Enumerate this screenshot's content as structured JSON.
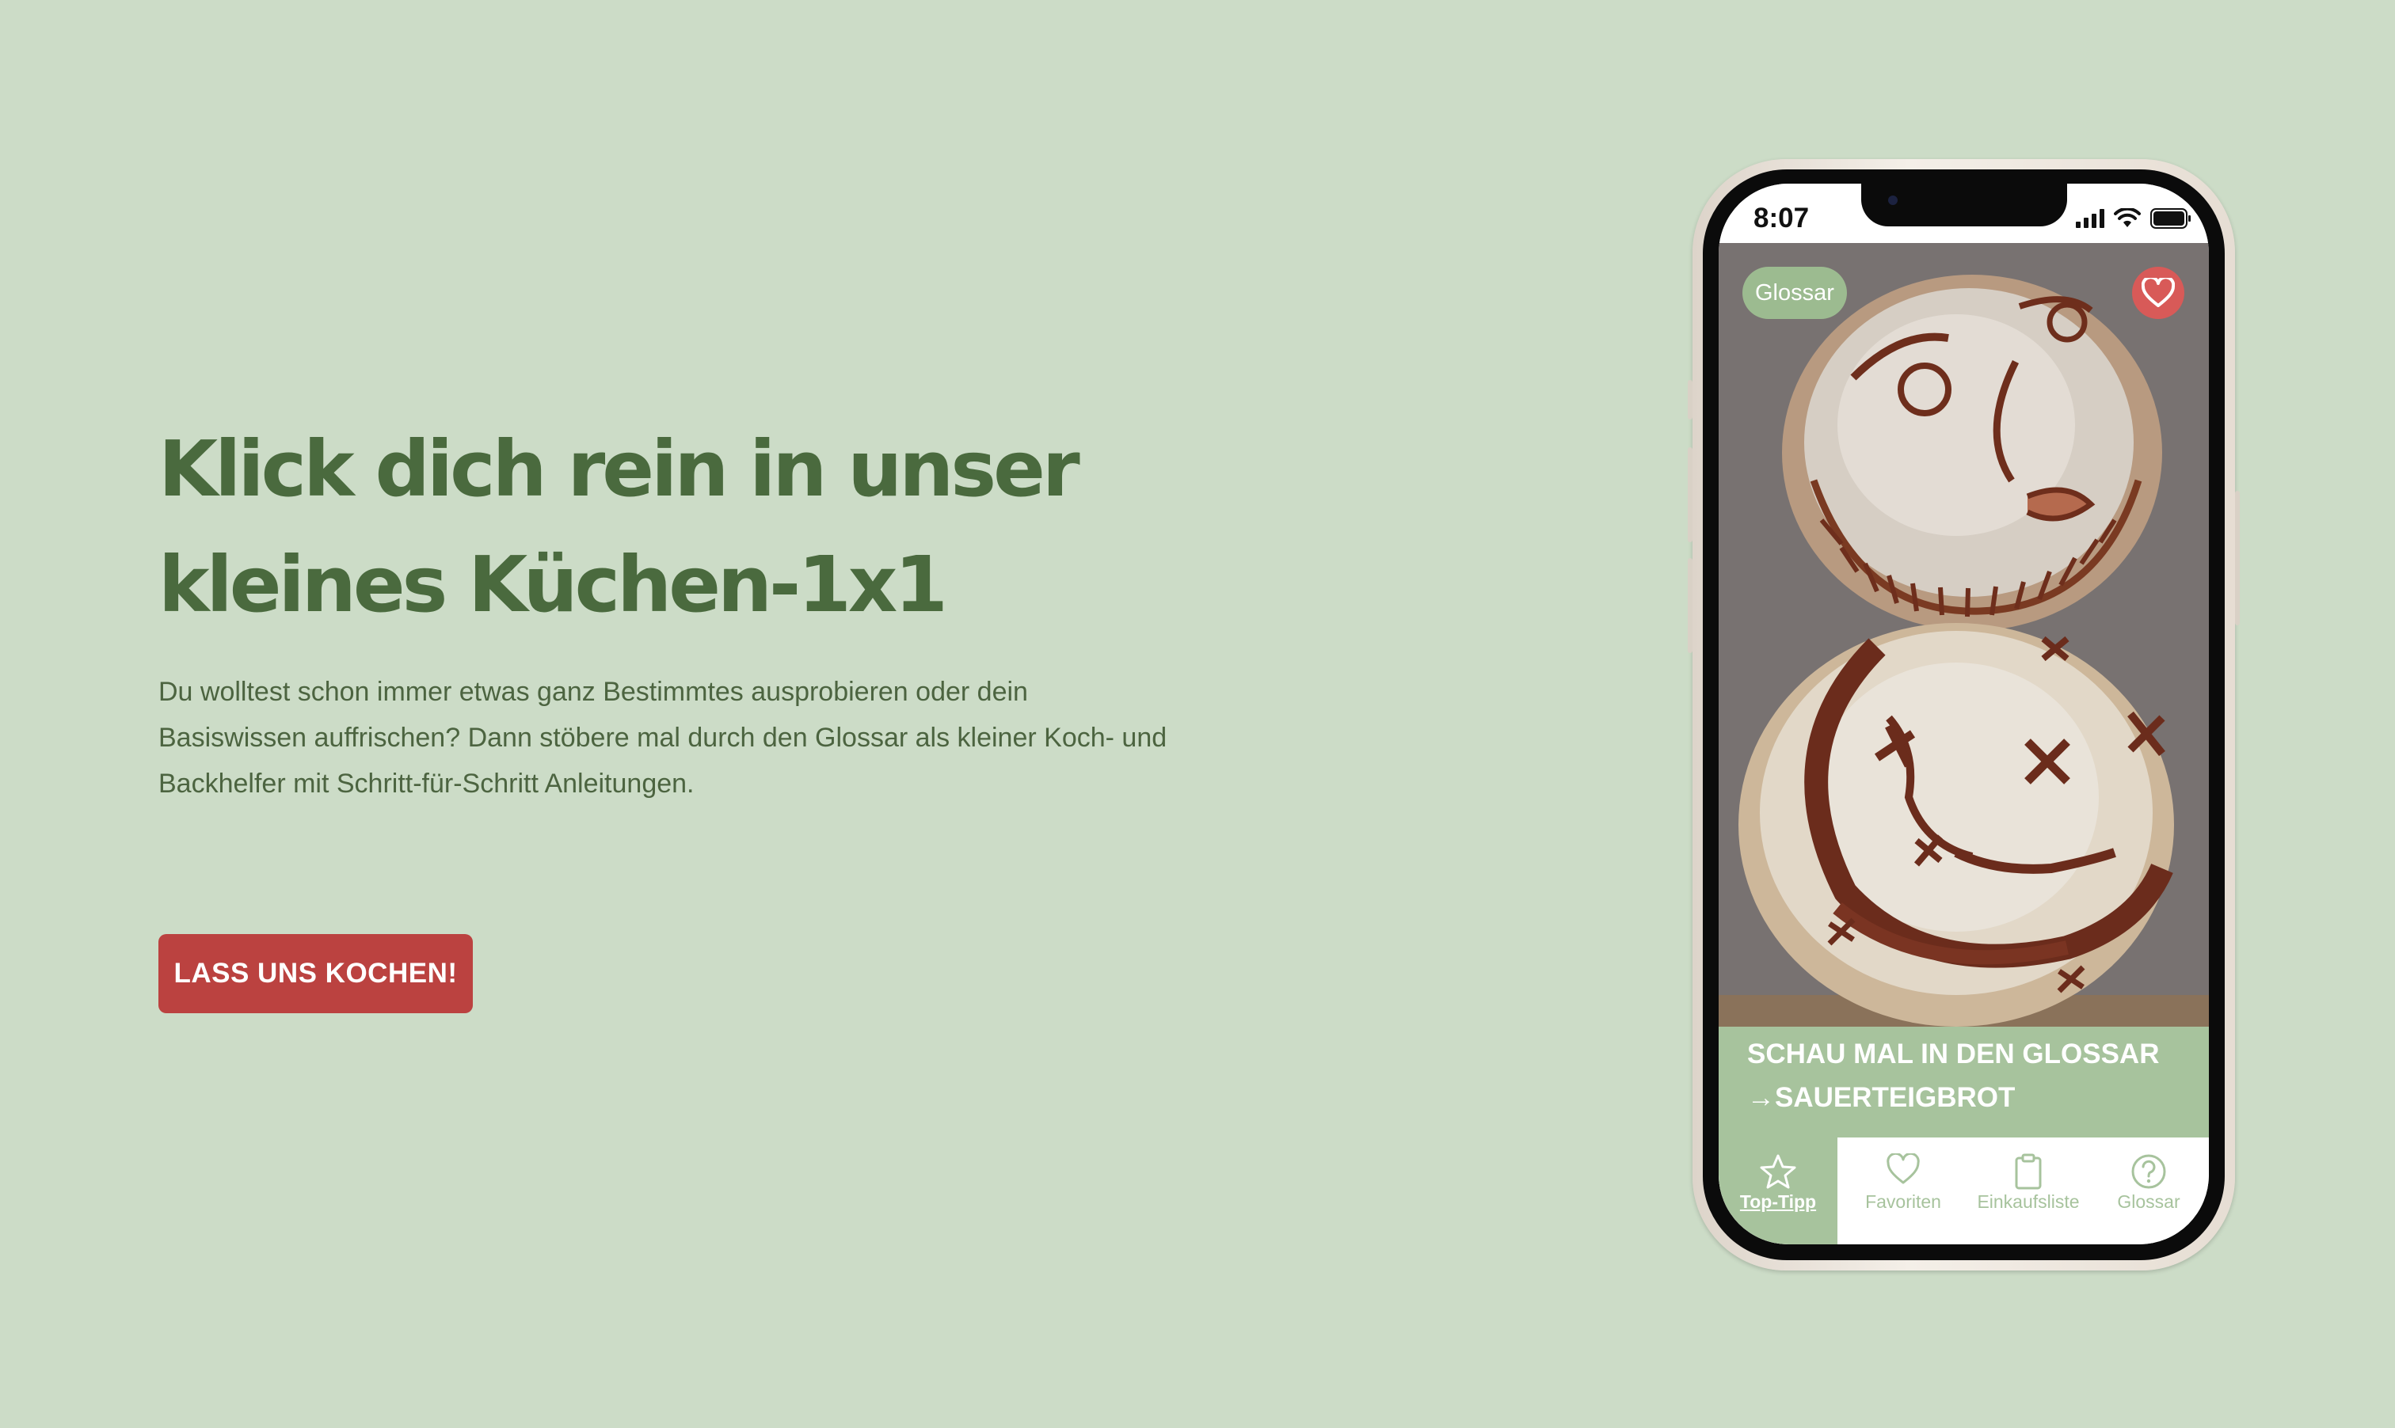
{
  "hero": {
    "title_line1": "Klick dich rein in unser",
    "title_line2": "kleines Küchen-1x1",
    "text_line1": "Du wolltest schon immer etwas ganz Bestimmtes ausprobieren oder dein",
    "text_line2": "Basiswissen auffrischen? Dann stöbere mal durch den Glossar als kleiner Koch- und",
    "text_line3": "Backhelfer mit Schritt-für-Schritt Anleitungen.",
    "cta_label": "LASS UNS KOCHEN!"
  },
  "phone": {
    "status_time": "8:07",
    "status_icons": [
      "signal-icon",
      "wifi-icon",
      "battery-icon"
    ],
    "chip_label": "Glossar",
    "favorite_icon": "heart-icon",
    "image_description_icon": "sourdough-bread-photo",
    "carousel": {
      "count": 4,
      "active_index": 0
    },
    "caption_line1": "SCHAU MAL IN DEN GLOSSAR",
    "caption_line2": "→SAUERTEIGBROT",
    "tabs": [
      {
        "label": "Top-Tipp",
        "icon": "star-icon",
        "active": true
      },
      {
        "label": "Favoriten",
        "icon": "heart-icon",
        "active": false
      },
      {
        "label": "Einkaufsliste",
        "icon": "clipboard-icon",
        "active": false
      },
      {
        "label": "Glossar",
        "icon": "question-icon",
        "active": false
      }
    ]
  },
  "colors": {
    "background": "#ccdcc7",
    "heading": "#4a6a3e",
    "body_text": "#4c6440",
    "cta": "#bb4240",
    "app_green": "#a7c39d",
    "favorite_red": "#d85a58"
  }
}
